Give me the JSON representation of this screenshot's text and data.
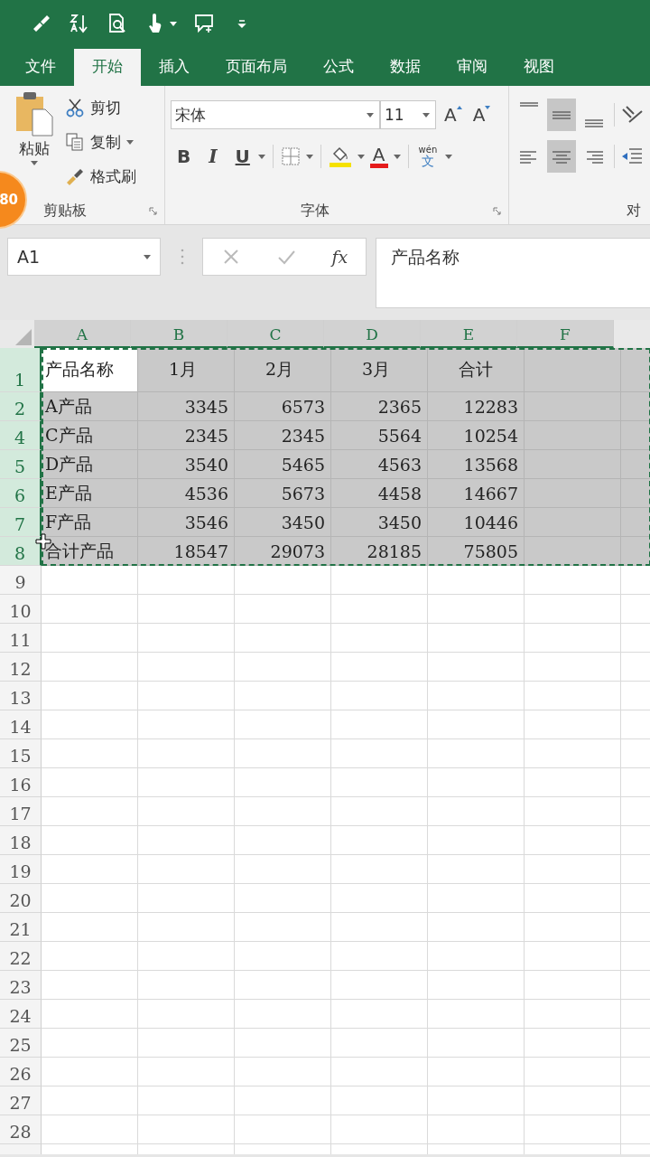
{
  "quick_access": [
    {
      "kind": "brush",
      "dropdown": false
    },
    {
      "kind": "sort",
      "dropdown": false
    },
    {
      "kind": "preview",
      "dropdown": false
    },
    {
      "kind": "touch",
      "dropdown": true
    },
    {
      "kind": "comment",
      "dropdown": false
    },
    {
      "kind": "customize",
      "dropdown": false
    }
  ],
  "tabs": [
    {
      "label": "文件",
      "selected": false
    },
    {
      "label": "开始",
      "selected": true
    },
    {
      "label": "插入",
      "selected": false
    },
    {
      "label": "页面布局",
      "selected": false
    },
    {
      "label": "公式",
      "selected": false
    },
    {
      "label": "数据",
      "selected": false
    },
    {
      "label": "审阅",
      "selected": false
    },
    {
      "label": "视图",
      "selected": false
    }
  ],
  "ribbon": {
    "clipboard": {
      "paste": "粘贴",
      "cut": "剪切",
      "copy": "复制",
      "format_painter": "格式刷",
      "label": "剪贴板"
    },
    "font": {
      "name": "宋体",
      "size": "11",
      "grow": "A",
      "shrink": "A",
      "bold": "B",
      "italic": "I",
      "underline": "U",
      "font_color": "A",
      "phonetic_top": "wén",
      "phonetic_bottom": "文",
      "label": "字体"
    },
    "alignment": {
      "vertical": [
        {
          "kind": "top",
          "selected": false
        },
        {
          "kind": "middle",
          "selected": true
        },
        {
          "kind": "bottom",
          "selected": false
        }
      ],
      "horizontal": [
        {
          "kind": "left",
          "selected": false
        },
        {
          "kind": "center",
          "selected": true
        },
        {
          "kind": "right",
          "selected": false
        }
      ],
      "label": "对"
    }
  },
  "badge": "80",
  "formula_bar": {
    "name_box": "A1",
    "function_label": "fx",
    "content": "产品名称"
  },
  "sheet": {
    "columns": [
      {
        "label": "A",
        "selected": true
      },
      {
        "label": "B",
        "selected": true
      },
      {
        "label": "C",
        "selected": true
      },
      {
        "label": "D",
        "selected": true
      },
      {
        "label": "E",
        "selected": true
      },
      {
        "label": "F",
        "selected": true
      }
    ],
    "rows": [
      {
        "number": "1",
        "selected": true,
        "kind": "header",
        "cells": [
          {
            "text": "产品名称",
            "active": true
          },
          {
            "text": "1月",
            "active": false
          },
          {
            "text": "2月",
            "active": false
          },
          {
            "text": "3月",
            "active": false
          },
          {
            "text": "合计",
            "active": false
          }
        ]
      },
      {
        "number": "2",
        "selected": true,
        "kind": "data",
        "cells": [
          {
            "text": "A产品",
            "active": false
          },
          {
            "text": "3345",
            "active": false
          },
          {
            "text": "6573",
            "active": false
          },
          {
            "text": "2365",
            "active": false
          },
          {
            "text": "12283",
            "active": false
          }
        ]
      },
      {
        "number": "4",
        "selected": true,
        "kind": "data",
        "cells": [
          {
            "text": "C产品",
            "active": false
          },
          {
            "text": "2345",
            "active": false
          },
          {
            "text": "2345",
            "active": false
          },
          {
            "text": "5564",
            "active": false
          },
          {
            "text": "10254",
            "active": false
          }
        ]
      },
      {
        "number": "5",
        "selected": true,
        "kind": "data",
        "cells": [
          {
            "text": "D产品",
            "active": false
          },
          {
            "text": "3540",
            "active": false
          },
          {
            "text": "5465",
            "active": false
          },
          {
            "text": "4563",
            "active": false
          },
          {
            "text": "13568",
            "active": false
          }
        ]
      },
      {
        "number": "6",
        "selected": true,
        "kind": "data",
        "cells": [
          {
            "text": "E产品",
            "active": false
          },
          {
            "text": "4536",
            "active": false
          },
          {
            "text": "5673",
            "active": false
          },
          {
            "text": "4458",
            "active": false
          },
          {
            "text": "14667",
            "active": false
          }
        ]
      },
      {
        "number": "7",
        "selected": true,
        "kind": "data",
        "cells": [
          {
            "text": "F产品",
            "active": false
          },
          {
            "text": "3546",
            "active": false
          },
          {
            "text": "3450",
            "active": false
          },
          {
            "text": "3450",
            "active": false
          },
          {
            "text": "10446",
            "active": false
          }
        ]
      },
      {
        "number": "8",
        "selected": true,
        "kind": "data",
        "cells": [
          {
            "text": "合计产品",
            "active": false
          },
          {
            "text": "18547",
            "active": false
          },
          {
            "text": "29073",
            "active": false
          },
          {
            "text": "28185",
            "active": false
          },
          {
            "text": "75805",
            "active": false
          }
        ]
      },
      {
        "number": "9",
        "selected": false,
        "kind": "empty"
      },
      {
        "number": "10",
        "selected": false,
        "kind": "empty"
      },
      {
        "number": "11",
        "selected": false,
        "kind": "empty"
      },
      {
        "number": "12",
        "selected": false,
        "kind": "empty"
      },
      {
        "number": "13",
        "selected": false,
        "kind": "empty"
      },
      {
        "number": "14",
        "selected": false,
        "kind": "empty"
      },
      {
        "number": "15",
        "selected": false,
        "kind": "empty"
      },
      {
        "number": "16",
        "selected": false,
        "kind": "empty"
      },
      {
        "number": "17",
        "selected": false,
        "kind": "empty"
      },
      {
        "number": "18",
        "selected": false,
        "kind": "empty"
      },
      {
        "number": "19",
        "selected": false,
        "kind": "empty"
      },
      {
        "number": "20",
        "selected": false,
        "kind": "empty"
      },
      {
        "number": "21",
        "selected": false,
        "kind": "empty"
      },
      {
        "number": "22",
        "selected": false,
        "kind": "empty"
      },
      {
        "number": "23",
        "selected": false,
        "kind": "empty"
      },
      {
        "number": "24",
        "selected": false,
        "kind": "empty"
      },
      {
        "number": "25",
        "selected": false,
        "kind": "empty"
      },
      {
        "number": "26",
        "selected": false,
        "kind": "empty"
      },
      {
        "number": "27",
        "selected": false,
        "kind": "empty"
      },
      {
        "number": "28",
        "selected": false,
        "kind": "empty"
      }
    ]
  }
}
